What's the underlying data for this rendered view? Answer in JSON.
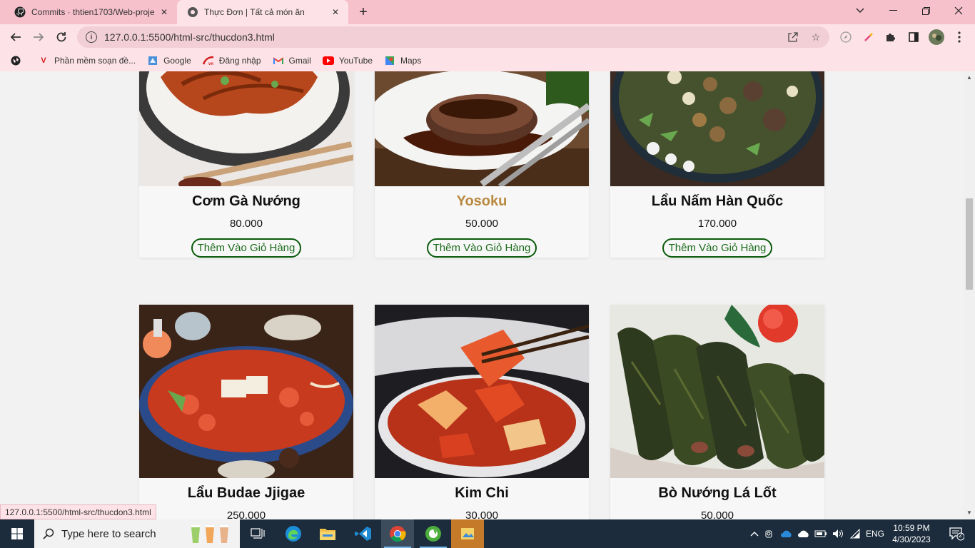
{
  "browser": {
    "tabs": [
      {
        "title": "Commits · thtien1703/Web-proje",
        "icon": "github-icon"
      },
      {
        "title": "Thực Đơn | Tất cả món ăn",
        "icon": "globe-icon"
      }
    ],
    "url": "127.0.0.1:5500/html-src/thucdon3.html",
    "bookmarks": [
      {
        "label": "Phần mềm soạn đề...",
        "icon": "v-logo-icon"
      },
      {
        "label": "Google",
        "icon": "google-icon"
      },
      {
        "label": "Đăng nhập",
        "icon": "login-icon"
      },
      {
        "label": "Gmail",
        "icon": "gmail-icon"
      },
      {
        "label": "YouTube",
        "icon": "youtube-icon"
      },
      {
        "label": "Maps",
        "icon": "maps-icon"
      }
    ],
    "status_url": "127.0.0.1:5500/html-src/thucdon3.html"
  },
  "menu": {
    "button_label": "Thêm Vào Giỏ Hàng",
    "items": [
      {
        "name": "Cơm Gà Nướng",
        "price": "80.000"
      },
      {
        "name": "Yosoku",
        "price": "50.000"
      },
      {
        "name": "Lẩu Nấm Hàn Quốc",
        "price": "170.000"
      },
      {
        "name": "Lẩu Budae Jjigae",
        "price": "250.000"
      },
      {
        "name": "Kim Chi",
        "price": "30.000"
      },
      {
        "name": "Bò Nướng Lá Lốt",
        "price": "50.000"
      }
    ]
  },
  "taskbar": {
    "search_placeholder": "Type here to search",
    "language": "ENG",
    "time": "10:59 PM",
    "date": "4/30/2023",
    "notification_count": "2"
  },
  "colors": {
    "tab_bar": "#f7c1cc",
    "toolbar": "#fde3e8",
    "hover_name": "#b8893f",
    "button_border": "#0a5a0a"
  }
}
